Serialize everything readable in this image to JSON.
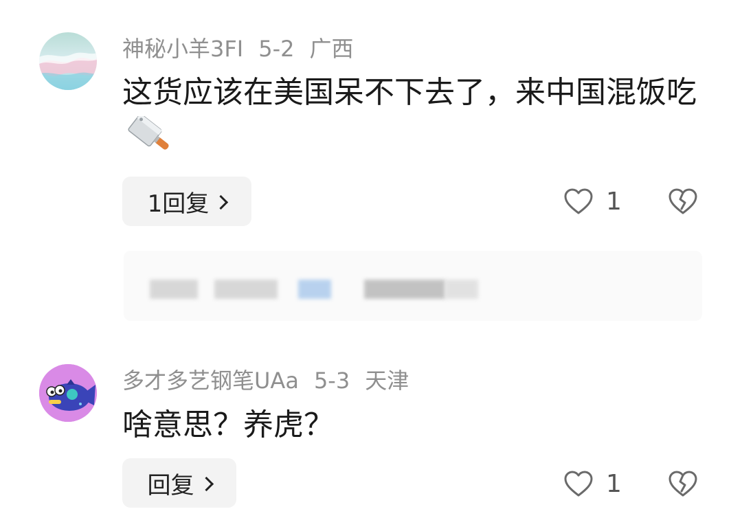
{
  "comments": [
    {
      "username": "神秘小羊3FI",
      "date": "5-2",
      "location": "广西",
      "text": "这货应该在美国呆不下去了，来中国混饭吃",
      "emoji": "kitchen-knife-icon",
      "reply_label": "1回复",
      "like_count": "1"
    },
    {
      "username": "多才多艺钢笔UAa",
      "date": "5-3",
      "location": "天津",
      "text": "啥意思？养虎？",
      "reply_label": "回复",
      "like_count": "1"
    }
  ],
  "colors": {
    "meta_text": "#8f8f8f",
    "reply_bg": "#f3f3f3",
    "avatar2_bg": "#d98ae6"
  }
}
